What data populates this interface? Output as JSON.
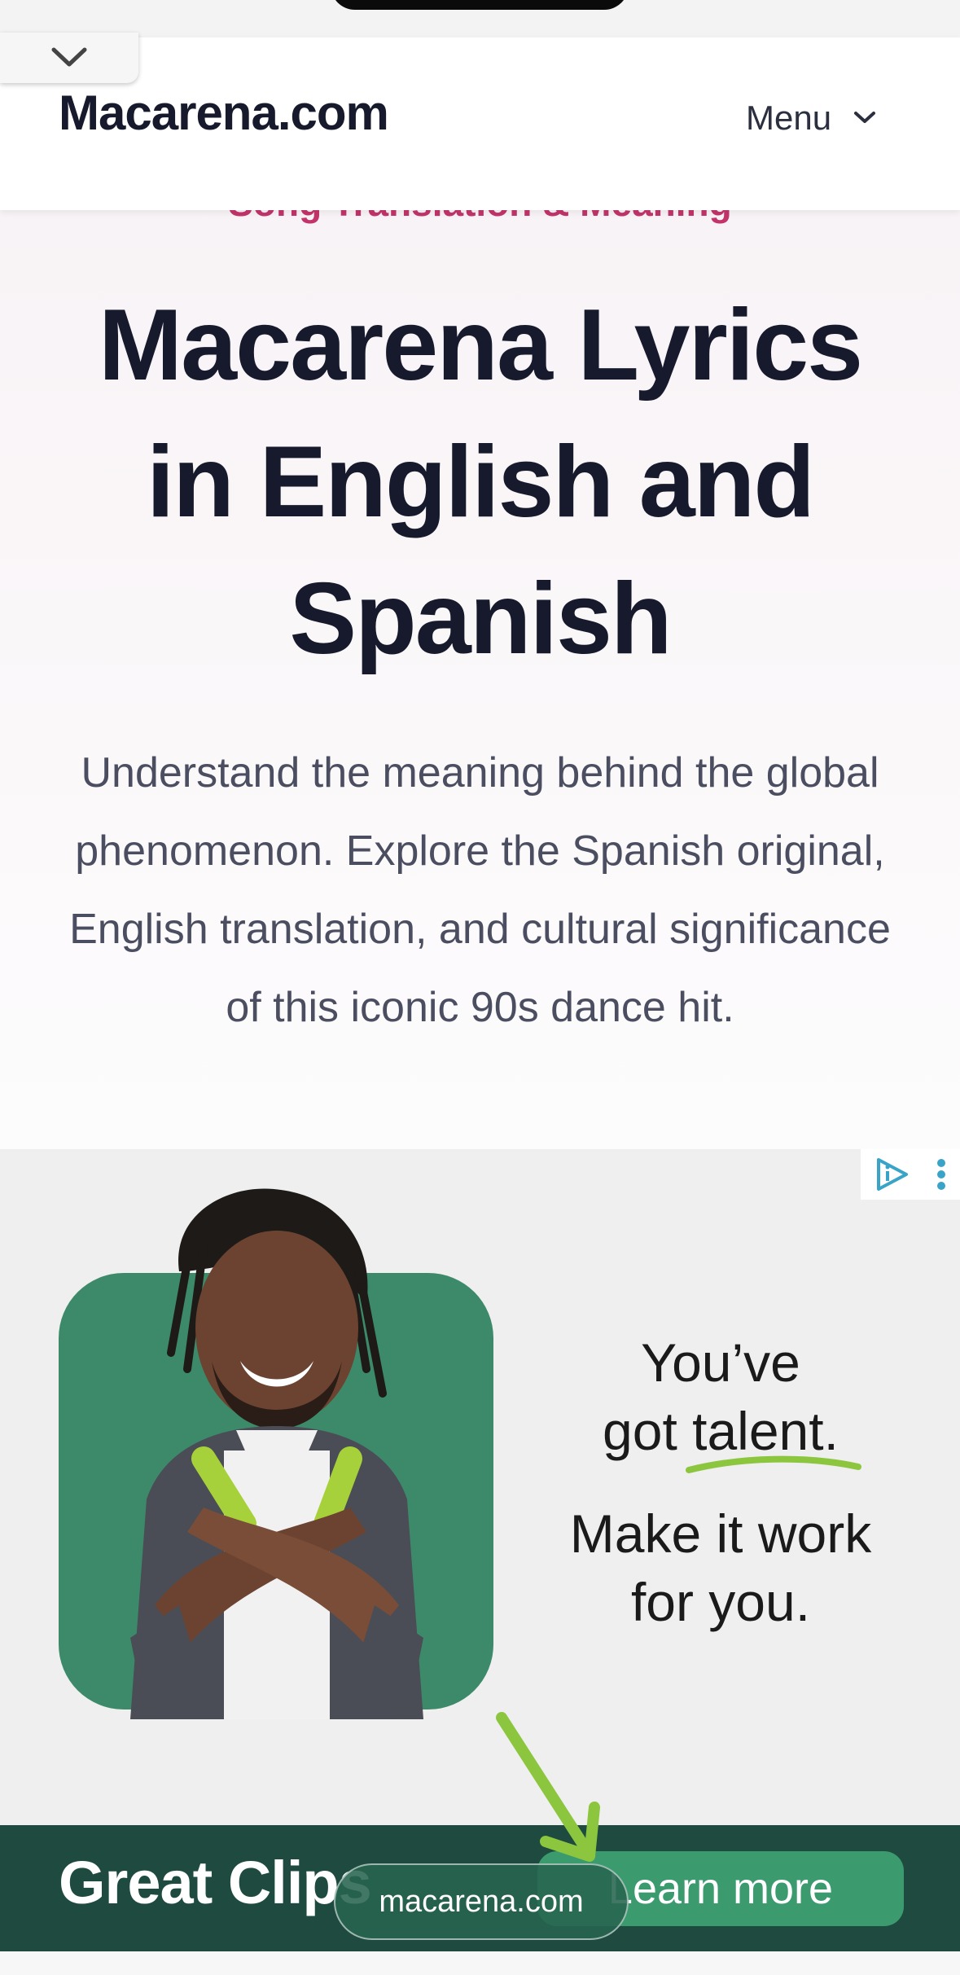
{
  "header": {
    "logo_text": "Macarena.com",
    "menu_label": "Menu"
  },
  "hero": {
    "kicker": "Song Translation & Meaning",
    "title": "Macarena Lyrics in English and Spanish",
    "subtitle": "Understand the meaning behind the global phenomenon. Explore the Spanish original, English translation, and cultural significance of this iconic 90s dance hit."
  },
  "ad": {
    "headline_line1": "You’ve",
    "headline_line2": "got talent.",
    "sub_line1": "Make it work",
    "sub_line2": "for you.",
    "brand": "Great Clips",
    "cta": "Learn more"
  },
  "browser": {
    "url": "macarena.com"
  },
  "colors": {
    "accent": "#c2346a",
    "title": "#161a2c",
    "ad_green": "#3d8a6a",
    "ad_footer": "#1e4a3f"
  }
}
